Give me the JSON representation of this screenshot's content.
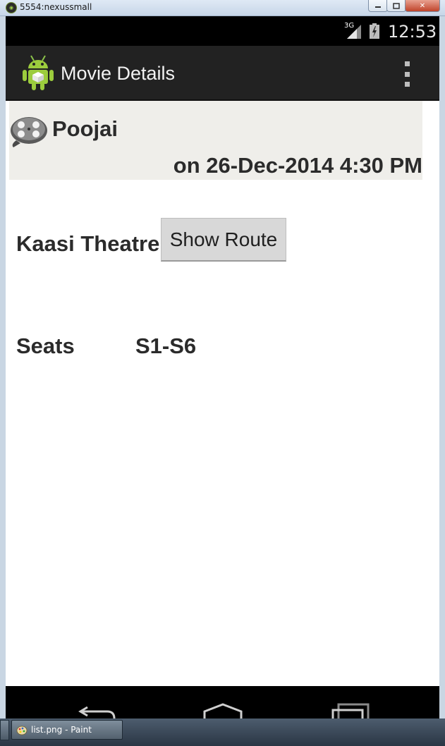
{
  "window": {
    "title": "5554:nexussmall",
    "icon": "android-emulator-icon",
    "icon_glyph": "◉",
    "controls": {
      "minimize": "minimize-icon",
      "maximize": "maximize-icon",
      "close": "close-icon",
      "close_glyph": "✕"
    }
  },
  "status_bar": {
    "network": "3G",
    "time": "12:53",
    "icons": [
      "signal-icon",
      "battery-icon"
    ]
  },
  "action_bar": {
    "title": "Movie Details",
    "logo": "android-logo-icon",
    "overflow_icon": "overflow-menu-icon"
  },
  "movie": {
    "name": "Poojai",
    "schedule": "on 26-Dec-2014 4:30 PM",
    "icon": "film-reel-icon",
    "theatre": "Kaasi Theatre",
    "show_route_label": "Show Route",
    "seats_label": "Seats",
    "seats_value": "S1-S6"
  },
  "nav_bar": {
    "icons": [
      "back-icon",
      "home-icon",
      "recent-apps-icon"
    ]
  },
  "taskbar": {
    "item_label": "list.png - Paint",
    "item_icon": "paint-icon"
  },
  "colors": {
    "action_bar": "#222222",
    "header_bg": "#efeeea",
    "text": "#2b2b2b",
    "button_bg": "#d8d8d8"
  }
}
